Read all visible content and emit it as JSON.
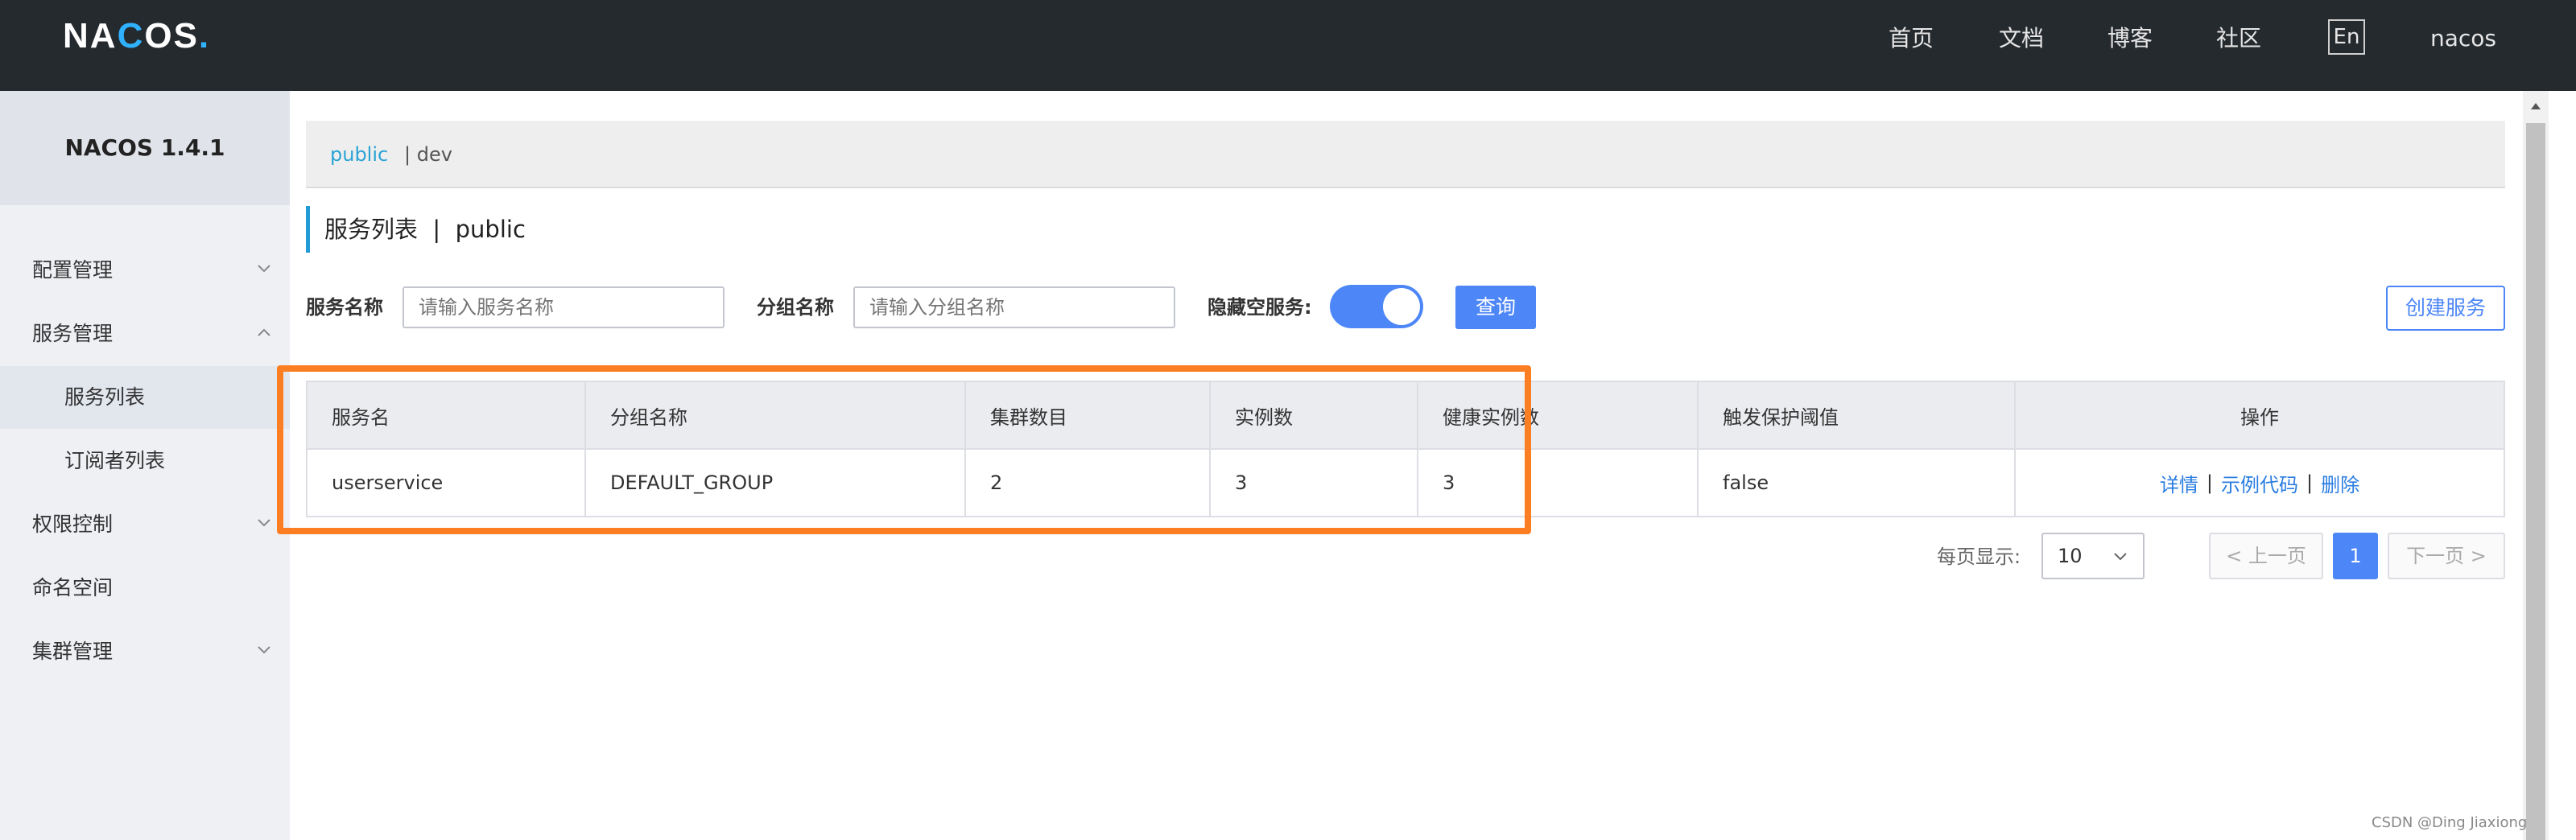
{
  "app": {
    "logo": "NACOS.",
    "nav": [
      "首页",
      "文档",
      "博客",
      "社区"
    ],
    "lang": "En",
    "user": "nacos"
  },
  "sidebar": {
    "title": "NACOS 1.4.1",
    "items": [
      {
        "label": "配置管理"
      },
      {
        "label": "服务管理"
      },
      {
        "label": "服务列表"
      },
      {
        "label": "订阅者列表"
      },
      {
        "label": "权限控制"
      },
      {
        "label": "命名空间"
      },
      {
        "label": "集群管理"
      }
    ]
  },
  "namespaces": {
    "active": "public",
    "other": "| dev"
  },
  "page": {
    "title": "服务列表  |  public"
  },
  "filters": {
    "service_label": "服务名称",
    "service_placeholder": "请输入服务名称",
    "group_label": "分组名称",
    "group_placeholder": "请输入分组名称",
    "hide_empty_label": "隐藏空服务:",
    "hide_empty_on": true,
    "query_button": "查询",
    "create_button": "创建服务"
  },
  "table": {
    "columns": [
      "服务名",
      "分组名称",
      "集群数目",
      "实例数",
      "健康实例数",
      "触发保护阈值",
      "操作"
    ],
    "rows": [
      {
        "service": "userservice",
        "group": "DEFAULT_GROUP",
        "clusters": "2",
        "instances": "3",
        "healthy": "3",
        "threshold": "false",
        "actions": [
          "详情",
          "示例代码",
          "删除"
        ]
      }
    ]
  },
  "pagination": {
    "per_page_label": "每页显示:",
    "per_page": "10",
    "prev": "< 上一页",
    "current": "1",
    "next": "下一页 >"
  },
  "watermark": "CSDN @Ding Jiaxiong",
  "colors": {
    "accent": "#4d86f7",
    "highlight": "#fb7e23",
    "link": "#2a7de1",
    "topbar": "#252a2f"
  }
}
